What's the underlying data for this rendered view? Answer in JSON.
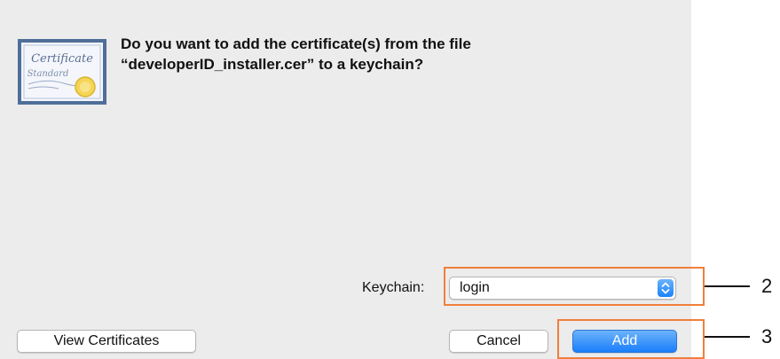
{
  "dialog": {
    "message_line1": "Do you want to add the certificate(s) from the file",
    "message_line2": "“developerID_installer.cer” to a keychain?",
    "certificate_icon": {
      "name": "certificate-icon",
      "title_text": "Certificate",
      "subtitle_text": "Standard"
    },
    "keychain": {
      "label": "Keychain:",
      "selected": "login"
    },
    "buttons": {
      "view_certificates": "View Certificates",
      "cancel": "Cancel",
      "add": "Add"
    }
  },
  "annotations": {
    "callout_keychain": "2",
    "callout_add": "3",
    "highlight_color": "#f07f3c"
  },
  "colors": {
    "dialog_background": "#ececec",
    "accent_blue": "#1a82fb"
  }
}
